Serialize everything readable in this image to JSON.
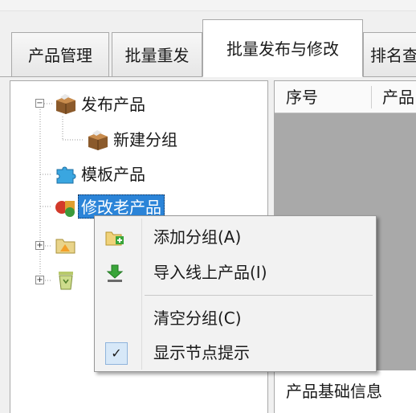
{
  "tabs": [
    {
      "label": "产品管理"
    },
    {
      "label": "批量重发"
    },
    {
      "label": "批量发布与修改",
      "active": true
    },
    {
      "label": "排名查询"
    }
  ],
  "tree": {
    "nodes": [
      {
        "label": "发布产品",
        "icon": "box-icon"
      },
      {
        "label": "新建分组",
        "icon": "box-icon"
      },
      {
        "label": "模板产品",
        "icon": "puzzle-icon"
      },
      {
        "label": "修改老产品",
        "icon": "products-icon",
        "selected": true
      }
    ]
  },
  "grid": {
    "columns": [
      {
        "label": "序号"
      },
      {
        "label": "产品"
      }
    ],
    "info_label": "产品基础信息"
  },
  "context_menu": {
    "items": [
      {
        "label": "添加分组(A)",
        "icon": "add-folder-icon"
      },
      {
        "label": "导入线上产品(I)",
        "icon": "import-icon"
      },
      {
        "label": "清空分组(C)"
      },
      {
        "label": "显示节点提示",
        "checked": true
      }
    ]
  },
  "colors": {
    "selection": "#2b84d8",
    "menu_background": "#f2f2f2",
    "grid_background": "#a9a9a9"
  }
}
